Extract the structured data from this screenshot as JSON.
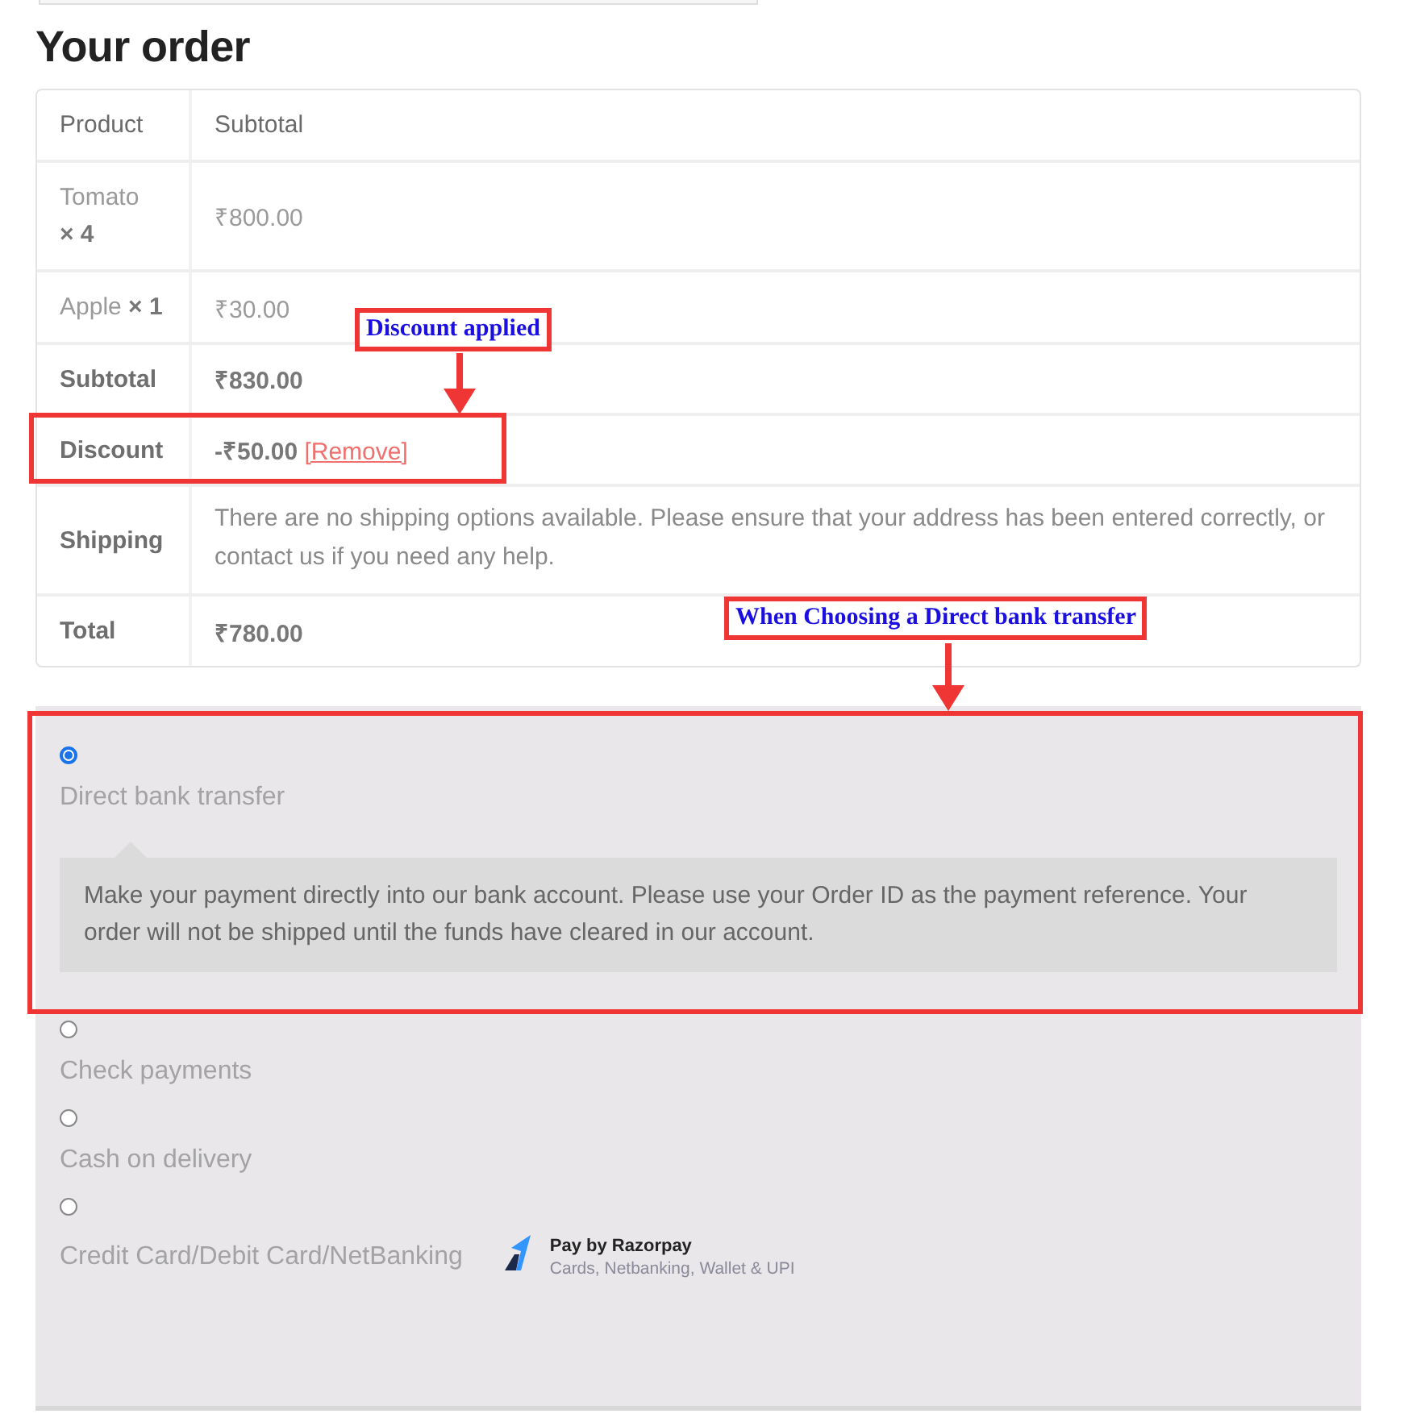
{
  "heading": "Your order",
  "table": {
    "columns": [
      "Product",
      "Subtotal"
    ],
    "rows": [
      {
        "kind": "item",
        "product": "Tomato",
        "quantity": "× 4",
        "amount": "₹800.00"
      },
      {
        "kind": "item",
        "product": "Apple ",
        "quantity": "× 1",
        "amount": "₹30.00"
      },
      {
        "kind": "total",
        "label": "Subtotal",
        "amount": "₹830.00"
      },
      {
        "kind": "discount",
        "label": "Discount",
        "amount": "-₹50.00",
        "link": "[Remove]"
      },
      {
        "kind": "note",
        "label": "Shipping",
        "text": "There are no shipping options available. Please ensure that your address has been entered correctly, or contact us if you need any help."
      },
      {
        "kind": "total",
        "label": "Total",
        "amount": "₹780.00"
      }
    ]
  },
  "payment_methods": [
    {
      "label": "Direct bank transfer",
      "selected": true,
      "description": "Make your payment directly into our bank account. Please use your Order ID as the payment reference. Your order will not be shipped until the funds have cleared in our account."
    },
    {
      "label": "Check payments",
      "selected": false
    },
    {
      "label": "Cash on delivery",
      "selected": false
    },
    {
      "label": "Credit Card/Debit Card/NetBanking",
      "selected": false,
      "badge": {
        "title": "Pay by Razorpay",
        "subtitle": "Cards, Netbanking, Wallet & UPI"
      }
    }
  ],
  "annotations": [
    {
      "label": "Discount applied"
    },
    {
      "label": "When Choosing a Direct bank transfer"
    }
  ]
}
